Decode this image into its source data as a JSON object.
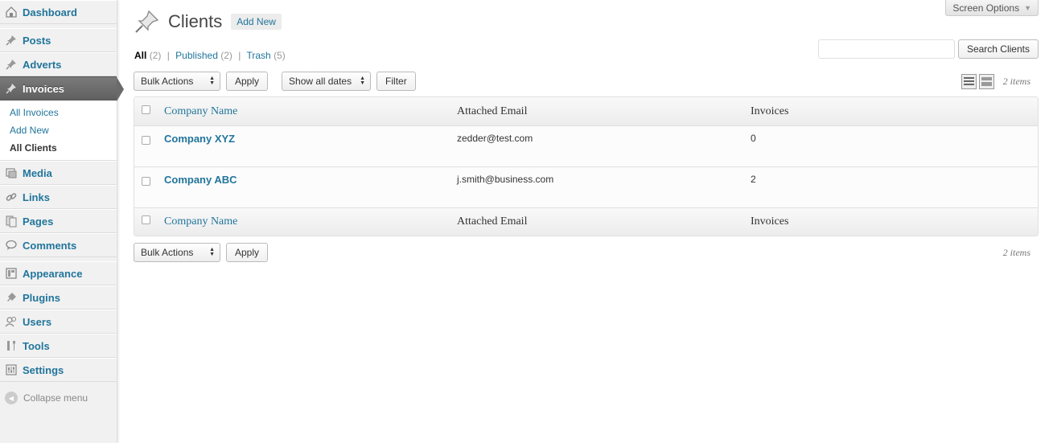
{
  "sidebar": {
    "items": [
      {
        "label": "Dashboard",
        "icon": "dashboard-icon"
      },
      {
        "label": "Posts",
        "icon": "pushpin-icon"
      },
      {
        "label": "Adverts",
        "icon": "pushpin-icon"
      },
      {
        "label": "Invoices",
        "icon": "pushpin-icon"
      },
      {
        "label": "Media",
        "icon": "media-icon"
      },
      {
        "label": "Links",
        "icon": "link-icon"
      },
      {
        "label": "Pages",
        "icon": "pages-icon"
      },
      {
        "label": "Comments",
        "icon": "comment-icon"
      },
      {
        "label": "Appearance",
        "icon": "appearance-icon"
      },
      {
        "label": "Plugins",
        "icon": "plugin-icon"
      },
      {
        "label": "Users",
        "icon": "users-icon"
      },
      {
        "label": "Tools",
        "icon": "tools-icon"
      },
      {
        "label": "Settings",
        "icon": "settings-icon"
      }
    ],
    "submenu": [
      {
        "label": "All Invoices"
      },
      {
        "label": "Add New"
      },
      {
        "label": "All Clients"
      }
    ],
    "collapse_label": "Collapse menu"
  },
  "header": {
    "screen_options": "Screen Options",
    "title": "Clients",
    "add_new": "Add New"
  },
  "filters": [
    {
      "label": "All",
      "count": "(2)"
    },
    {
      "label": "Published",
      "count": "(2)"
    },
    {
      "label": "Trash",
      "count": "(5)"
    }
  ],
  "search": {
    "placeholder": "",
    "button": "Search Clients"
  },
  "tablenav_top": {
    "bulk_actions": "Bulk Actions",
    "apply": "Apply",
    "dates": "Show all dates",
    "filter": "Filter",
    "items": "2 items"
  },
  "tablenav_bottom": {
    "bulk_actions": "Bulk Actions",
    "apply": "Apply",
    "items": "2 items"
  },
  "table": {
    "columns": [
      "Company Name",
      "Attached Email",
      "Invoices"
    ],
    "rows": [
      {
        "name": "Company XYZ",
        "email": "zedder@test.com",
        "invoices": "0"
      },
      {
        "name": "Company ABC",
        "email": "j.smith@business.com",
        "invoices": "2"
      }
    ]
  },
  "colors": {
    "link": "#21759b",
    "active_menu": "#6a6a6a"
  }
}
